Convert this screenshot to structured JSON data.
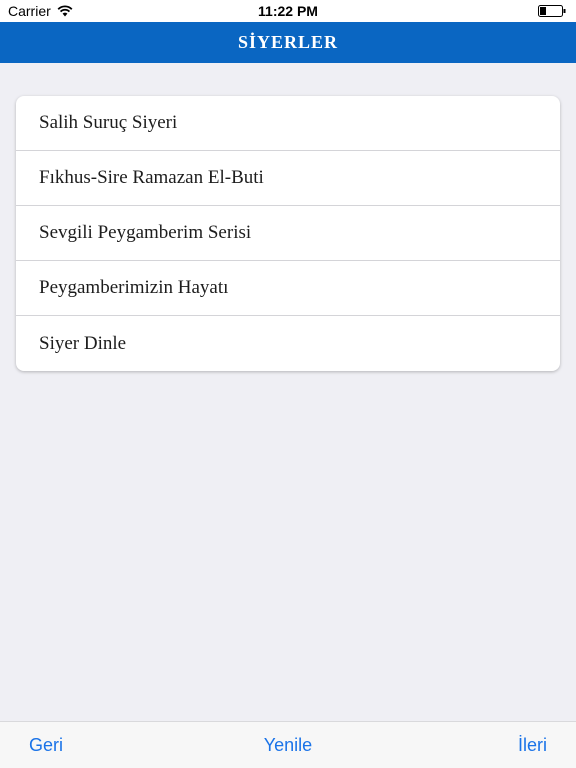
{
  "status_bar": {
    "carrier": "Carrier",
    "time": "11:22 PM",
    "wifi_icon": "wifi-icon",
    "battery_icon": "battery-icon"
  },
  "header": {
    "title": "SİYERLER",
    "background_color": "#0a66c2"
  },
  "list": {
    "items": [
      {
        "label": "Salih Suruç Siyeri"
      },
      {
        "label": "Fıkhus-Sire Ramazan El-Buti"
      },
      {
        "label": "Sevgili Peygamberim Serisi"
      },
      {
        "label": "Peygamberimizin Hayatı"
      },
      {
        "label": "Siyer Dinle"
      }
    ]
  },
  "toolbar": {
    "back_label": "Geri",
    "refresh_label": "Yenile",
    "forward_label": "İleri",
    "accent_color": "#1a73e8"
  }
}
